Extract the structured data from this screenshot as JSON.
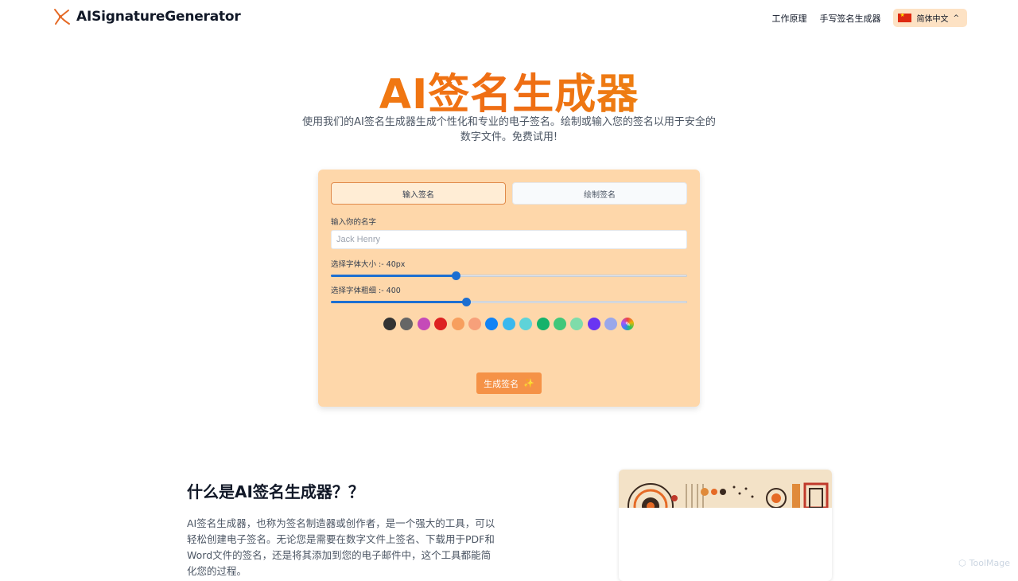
{
  "header": {
    "logo_text": "AISignatureGenerator",
    "nav": [
      {
        "label": "工作原理"
      },
      {
        "label": "手写签名生成器"
      }
    ],
    "language": {
      "label": "简体中文",
      "flag_icon": "china-flag-icon"
    }
  },
  "hero": {
    "title": "AI签名生成器",
    "subtitle": "使用我们的AI签名生成器生成个性化和专业的电子签名。绘制或输入您的签名以用于安全的数字文件。免费试用!"
  },
  "generator": {
    "tabs": [
      {
        "label": "输入签名",
        "active": true
      },
      {
        "label": "绘制签名",
        "active": false
      }
    ],
    "name_label": "输入你的名字",
    "name_placeholder": "Jack Henry",
    "name_value": "",
    "font_size_label": "选择字体大小 :- 40px",
    "font_size_fraction": 0.35,
    "font_weight_label": "选择字体粗细 :- 400",
    "font_weight_fraction": 0.38,
    "colors": [
      "#333333",
      "#666666",
      "#c54ab8",
      "#dd2222",
      "#f79f5e",
      "#f7a07a",
      "#1183f5",
      "#3ab8ee",
      "#5ed3d8",
      "#15b26b",
      "#41c77a",
      "#7fdcaa",
      "#6a35f2",
      "#9aa7ea"
    ],
    "color_picker_icon": "color-wheel-icon",
    "generate_label": "生成签名",
    "generate_icon": "sparkles-icon"
  },
  "about": {
    "title": "什么是AI签名生成器？？",
    "body": "AI签名生成器，也称为签名制造器或创作者，是一个强大的工具，可以轻松创建电子签名。无论您是需要在数字文件上签名、下载用于PDF和Word文件的签名，还是将其添加到您的电子邮件中，这个工具都能简化您的过程。"
  },
  "watermark": {
    "label": "ToolMage"
  },
  "colors": {
    "accent": "#f59247",
    "card_bg": "#fed7aa",
    "slider": "#1d6fd1"
  }
}
